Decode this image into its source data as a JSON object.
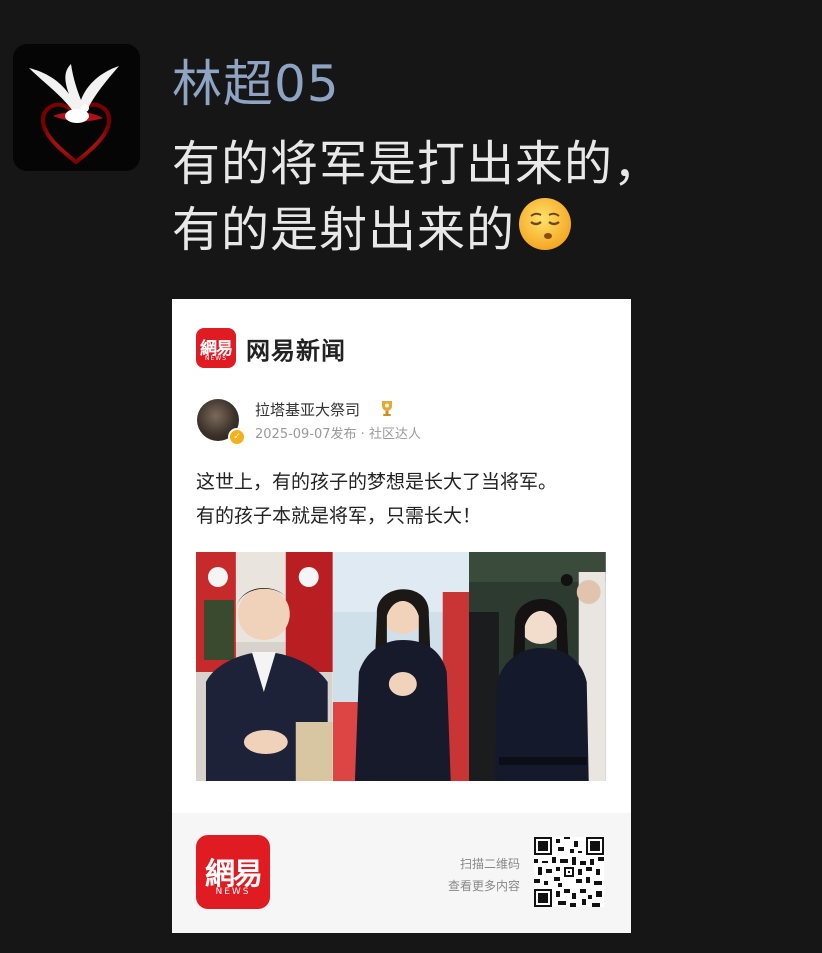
{
  "post": {
    "username": "林超05",
    "message_line1": "有的将军是打出来的，",
    "message_line2": "有的是射出来的",
    "emoji": "face-with-closed-eyes-emoji"
  },
  "card": {
    "brand_logo_text": "網易",
    "brand_logo_sub": "NEWS",
    "brand_name": "网易新闻",
    "author_name": "拉塔基亚大祭司",
    "author_meta": "2025-09-07发布 · 社区达人",
    "text_line1": "这世上，有的孩子的梦想是长大了当将军。",
    "text_line2": "有的孩子本就是将军，只需长大！",
    "footer_logo_text": "網易",
    "footer_logo_sub": "NEWS",
    "qr_line1": "扫描二维码",
    "qr_line2": "查看更多内容"
  },
  "colors": {
    "background": "#161616",
    "username": "#8ea4c2",
    "message": "#e8e8e8",
    "brand_red": "#e11b22"
  }
}
